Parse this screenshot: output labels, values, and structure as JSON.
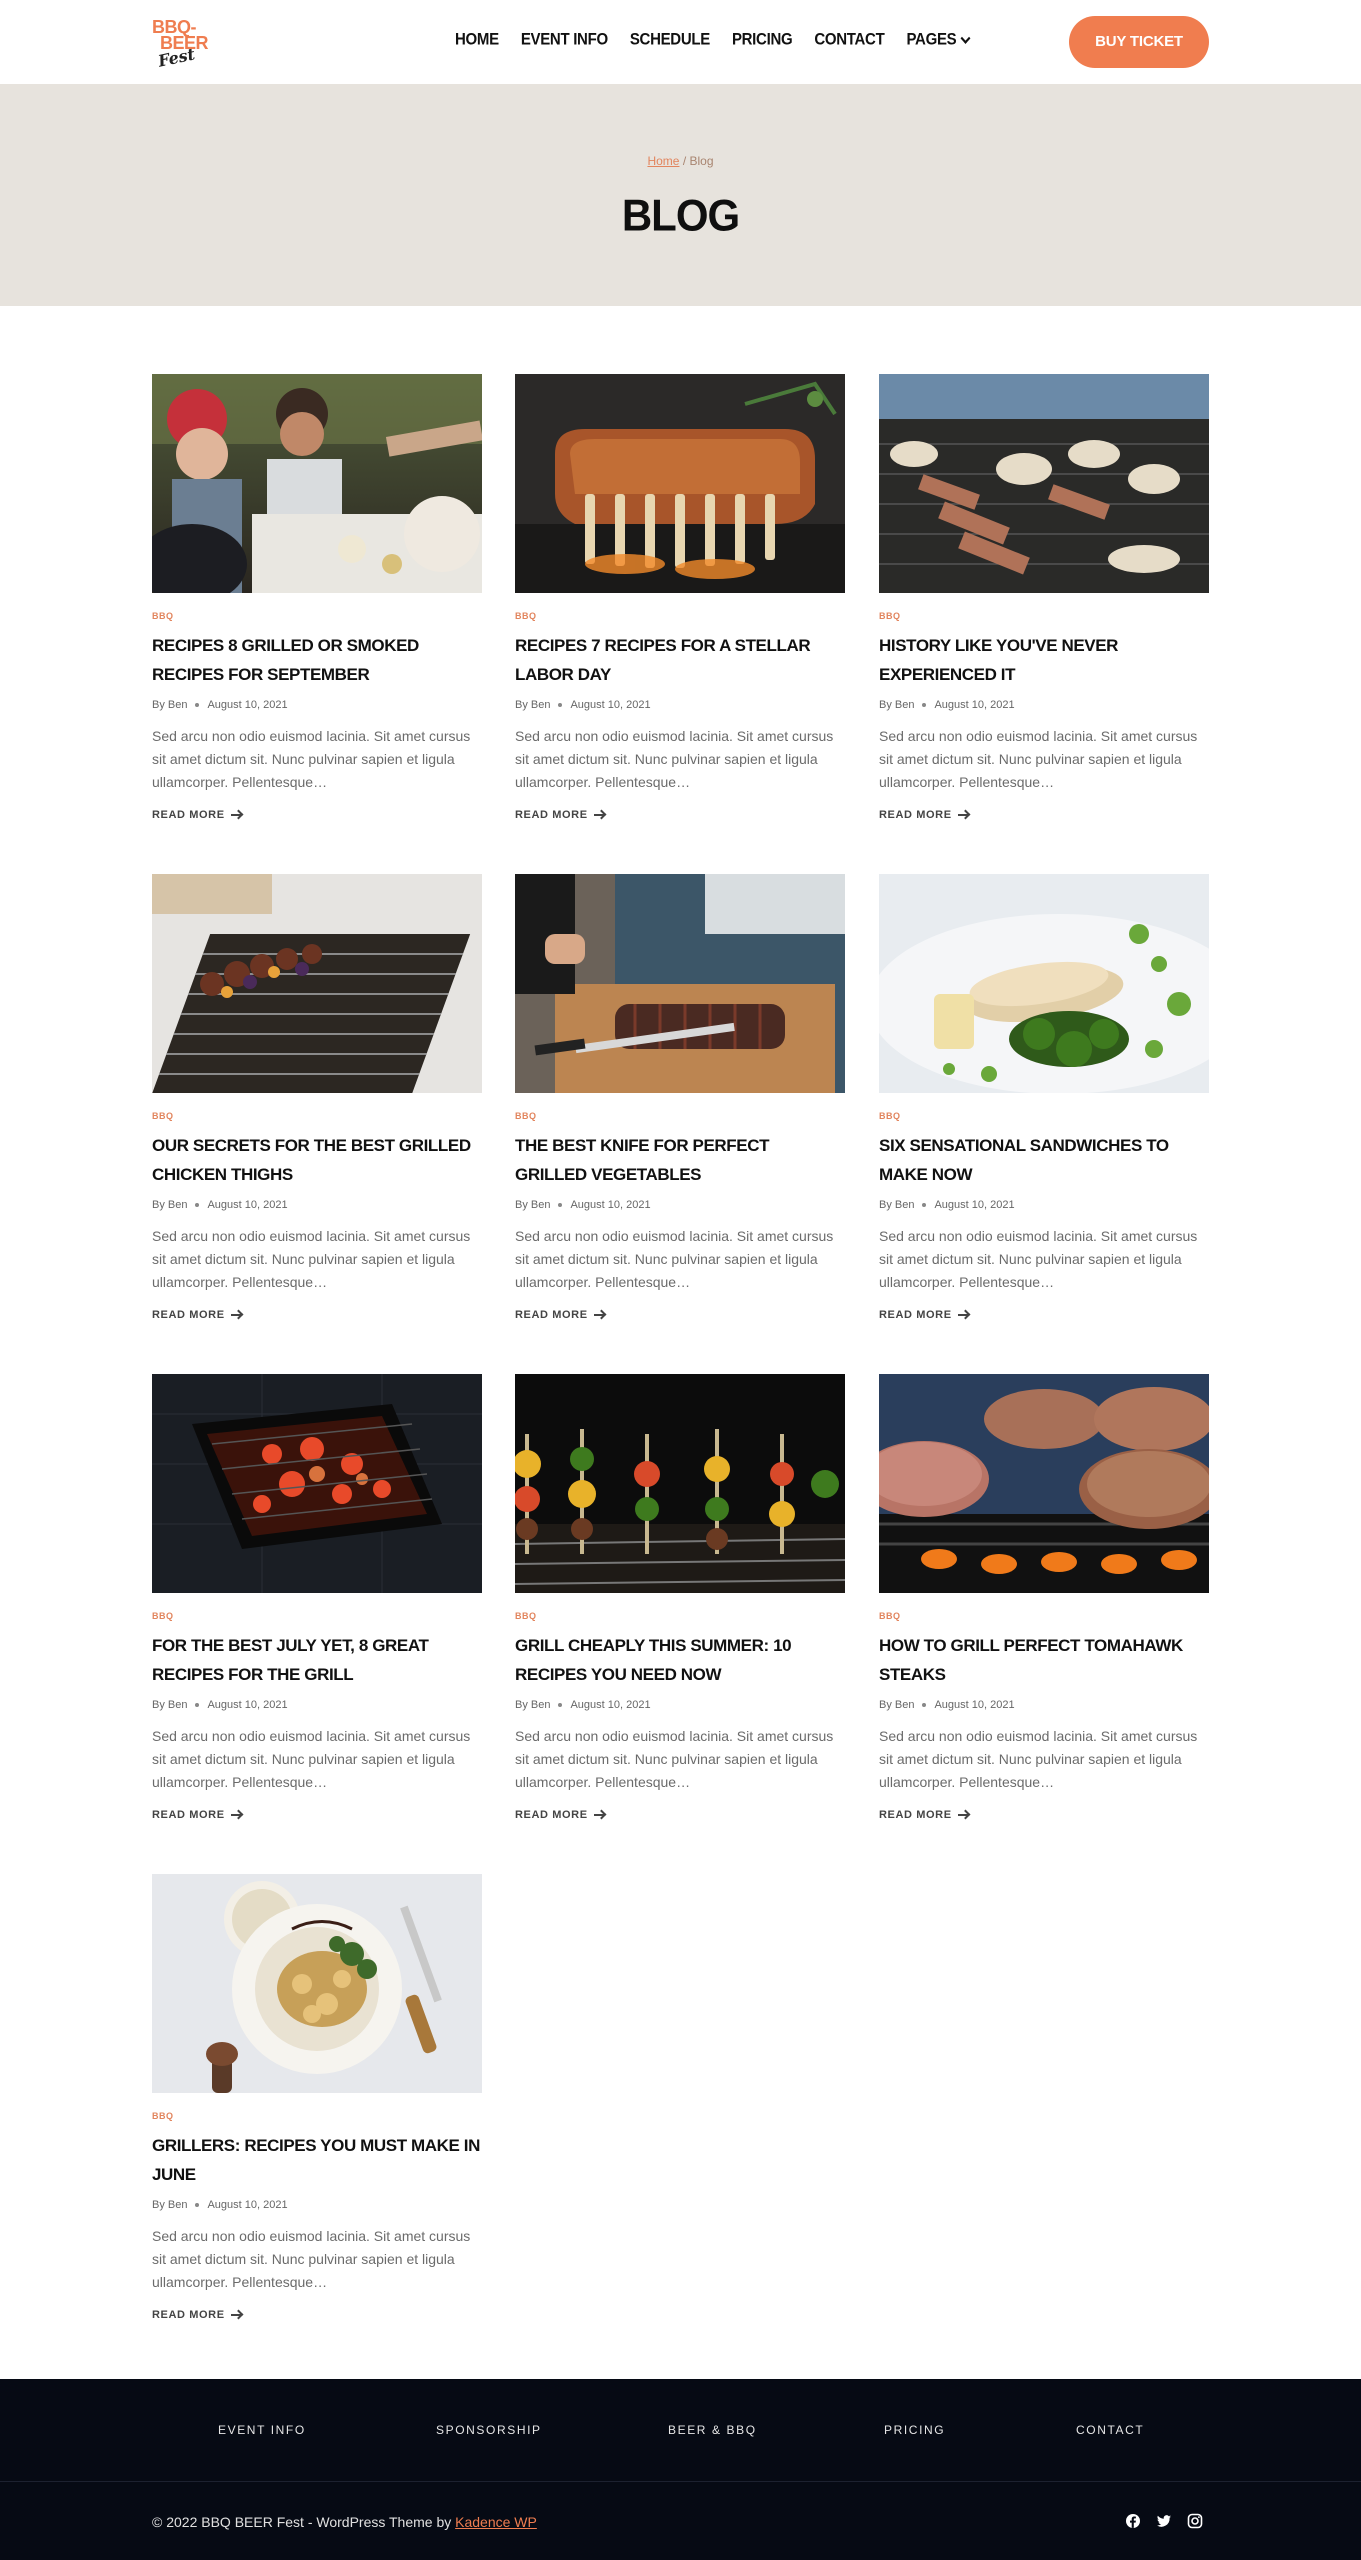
{
  "header": {
    "logo": {
      "line1": "BBQ-",
      "line2": "BEER",
      "line3": "Fest"
    },
    "nav": [
      "HOME",
      "EVENT INFO",
      "SCHEDULE",
      "PRICING",
      "CONTACT",
      "PAGES"
    ],
    "buy_ticket": "BUY TICKET"
  },
  "hero": {
    "breadcrumb_home": "Home",
    "breadcrumb_sep": "/",
    "breadcrumb_current": "Blog",
    "title": "BLOG"
  },
  "posts": [
    {
      "category": "BBQ",
      "title": "RECIPES 8 GRILLED OR SMOKED RECIPES FOR SEPTEMBER",
      "author": "By Ben",
      "date": "August 10, 2021",
      "excerpt": "Sed arcu non odio euismod lacinia. Sit amet cursus sit amet dictum sit. Nunc pulvinar sapien et ligula ullamcorper. Pellentesque…",
      "read_more": "READ MORE"
    },
    {
      "category": "BBQ",
      "title": "RECIPES 7 RECIPES FOR A STELLAR LABOR DAY",
      "author": "By Ben",
      "date": "August 10, 2021",
      "excerpt": "Sed arcu non odio euismod lacinia. Sit amet cursus sit amet dictum sit. Nunc pulvinar sapien et ligula ullamcorper. Pellentesque…",
      "read_more": "READ MORE"
    },
    {
      "category": "BBQ",
      "title": "HISTORY LIKE YOU'VE NEVER EXPERIENCED IT",
      "author": "By Ben",
      "date": "August 10, 2021",
      "excerpt": "Sed arcu non odio euismod lacinia. Sit amet cursus sit amet dictum sit. Nunc pulvinar sapien et ligula ullamcorper. Pellentesque…",
      "read_more": "READ MORE"
    },
    {
      "category": "BBQ",
      "title": "OUR SECRETS FOR THE BEST GRILLED CHICKEN THIGHS",
      "author": "By Ben",
      "date": "August 10, 2021",
      "excerpt": "Sed arcu non odio euismod lacinia. Sit amet cursus sit amet dictum sit. Nunc pulvinar sapien et ligula ullamcorper. Pellentesque…",
      "read_more": "READ MORE"
    },
    {
      "category": "BBQ",
      "title": "THE BEST KNIFE FOR PERFECT GRILLED VEGETABLES",
      "author": "By Ben",
      "date": "August 10, 2021",
      "excerpt": "Sed arcu non odio euismod lacinia. Sit amet cursus sit amet dictum sit. Nunc pulvinar sapien et ligula ullamcorper. Pellentesque…",
      "read_more": "READ MORE"
    },
    {
      "category": "BBQ",
      "title": "SIX SENSATIONAL SANDWICHES TO MAKE NOW",
      "author": "By Ben",
      "date": "August 10, 2021",
      "excerpt": "Sed arcu non odio euismod lacinia. Sit amet cursus sit amet dictum sit. Nunc pulvinar sapien et ligula ullamcorper. Pellentesque…",
      "read_more": "READ MORE"
    },
    {
      "category": "BBQ",
      "title": "FOR THE BEST JULY YET, 8 GREAT RECIPES FOR THE GRILL",
      "author": "By Ben",
      "date": "August 10, 2021",
      "excerpt": "Sed arcu non odio euismod lacinia. Sit amet cursus sit amet dictum sit. Nunc pulvinar sapien et ligula ullamcorper. Pellentesque…",
      "read_more": "READ MORE"
    },
    {
      "category": "BBQ",
      "title": "GRILL CHEAPLY THIS SUMMER: 10 RECIPES YOU NEED NOW",
      "author": "By Ben",
      "date": "August 10, 2021",
      "excerpt": "Sed arcu non odio euismod lacinia. Sit amet cursus sit amet dictum sit. Nunc pulvinar sapien et ligula ullamcorper. Pellentesque…",
      "read_more": "READ MORE"
    },
    {
      "category": "BBQ",
      "title": "HOW TO GRILL PERFECT TOMAHAWK STEAKS",
      "author": "By Ben",
      "date": "August 10, 2021",
      "excerpt": "Sed arcu non odio euismod lacinia. Sit amet cursus sit amet dictum sit. Nunc pulvinar sapien et ligula ullamcorper. Pellentesque…",
      "read_more": "READ MORE"
    },
    {
      "category": "BBQ",
      "title": "GRILLERS: RECIPES YOU MUST MAKE IN JUNE",
      "author": "By Ben",
      "date": "August 10, 2021",
      "excerpt": "Sed arcu non odio euismod lacinia. Sit amet cursus sit amet dictum sit. Nunc pulvinar sapien et ligula ullamcorper. Pellentesque…",
      "read_more": "READ MORE"
    }
  ],
  "footer": {
    "nav": [
      "EVENT INFO",
      "SPONSORSHIP",
      "BEER & BBQ",
      "PRICING",
      "CONTACT"
    ],
    "copyright": "© 2022 BBQ BEER Fest - WordPress Theme by",
    "credit_link": "Kadence WP",
    "social_icons": [
      "facebook-icon",
      "twitter-icon",
      "instagram-icon"
    ]
  },
  "colors": {
    "accent": "#f07d4f",
    "hero_bg": "#e7e3dd",
    "footer_bg": "#060a14"
  }
}
